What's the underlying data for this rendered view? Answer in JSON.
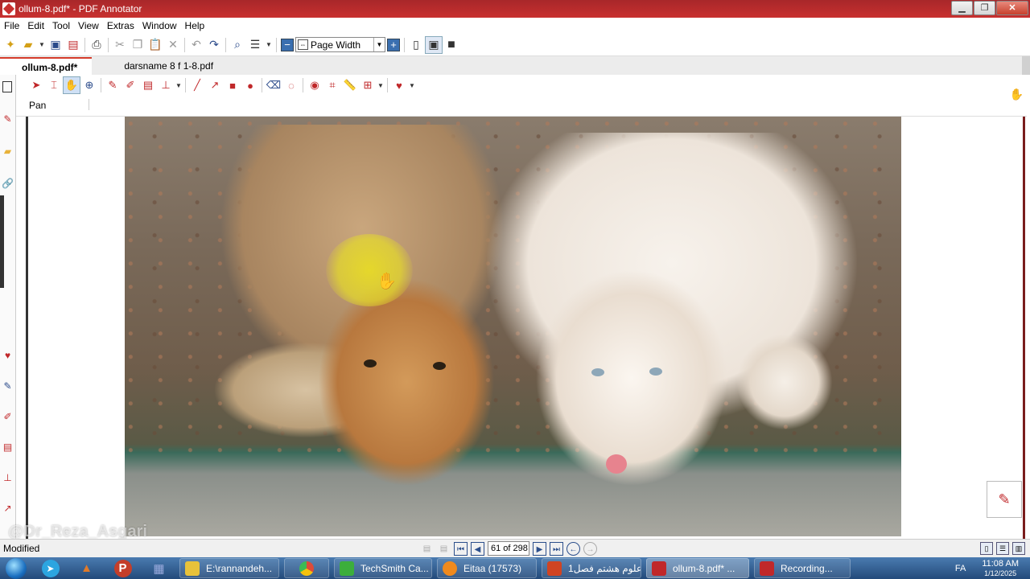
{
  "window": {
    "title": "ollum-8.pdf* - PDF Annotator",
    "controls": {
      "minimize": "▁",
      "maximize": "❐",
      "close": "✕"
    }
  },
  "menu": [
    "File",
    "Edit",
    "Tool",
    "View",
    "Extras",
    "Window",
    "Help"
  ],
  "toolbar": {
    "zoom_value": "Page Width"
  },
  "tabs": [
    {
      "label": "ollum-8.pdf*",
      "active": true
    },
    {
      "label": "darsname 8 f 1-8.pdf",
      "active": false
    }
  ],
  "annotation_toolbar": {
    "current_tool_label": "Pan"
  },
  "document": {
    "watermark": "@Dr_Reza_Asgari"
  },
  "status": {
    "text": "Modified",
    "page_indicator": "61 of 298"
  },
  "taskbar": {
    "items": [
      {
        "label": "E:\\rannandeh...",
        "color": "#e8c23a"
      },
      {
        "label": "",
        "color": "#dd4b39"
      },
      {
        "label": "TechSmith Ca...",
        "color": "#3cae3c"
      },
      {
        "label": "Eitaa (17573)",
        "color": "#f08a1d"
      },
      {
        "label": "علوم هشتم فصل1...",
        "color": "#d04423"
      },
      {
        "label": "ollum-8.pdf* ...",
        "color": "#c0282a",
        "active": true
      },
      {
        "label": "Recording...",
        "color": "#c0282a"
      }
    ],
    "language": "FA",
    "time": "11:08 AM",
    "date": "1/12/2025"
  },
  "colors": {
    "accent": "#c8302f",
    "taskbar": "#234a7a",
    "highlight": "#ece21e"
  }
}
